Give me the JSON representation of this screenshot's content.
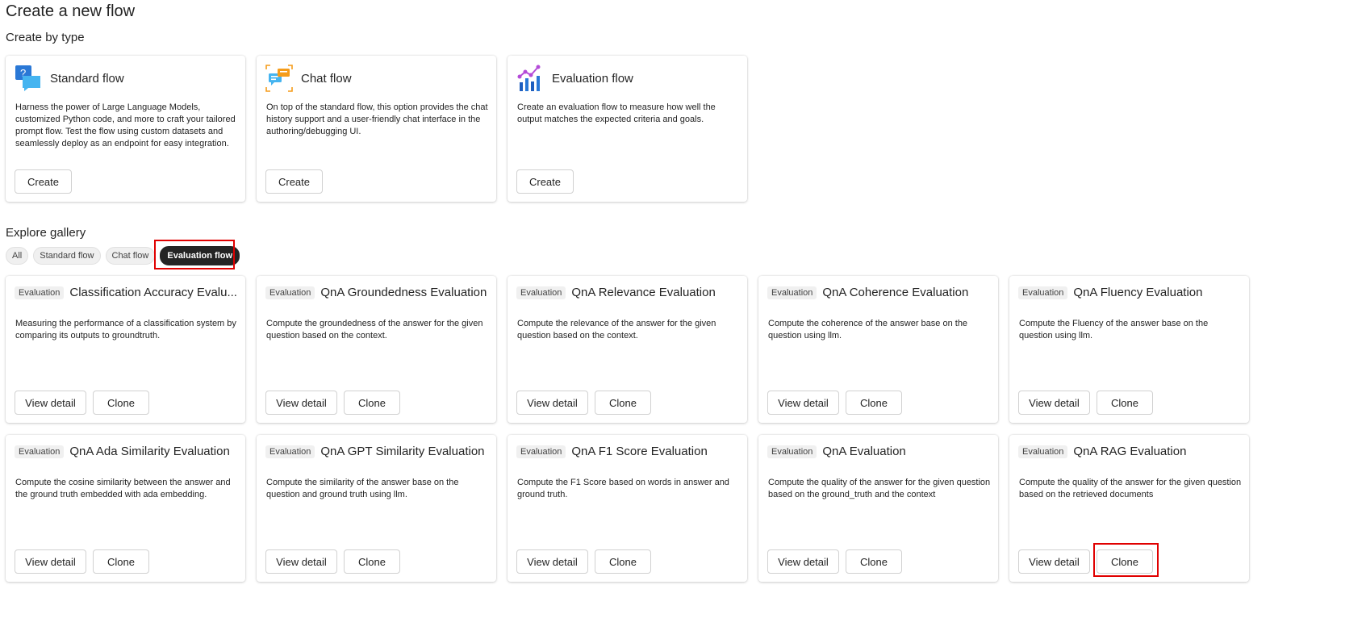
{
  "page": {
    "title": "Create a new flow"
  },
  "create_by_type": {
    "heading": "Create by type",
    "cards": [
      {
        "name": "Standard flow",
        "icon": "standard-flow-icon",
        "description": "Harness the power of Large Language Models, customized Python code, and more to craft your tailored prompt flow. Test the flow using custom datasets and seamlessly deploy as an endpoint for easy integration.",
        "button": "Create"
      },
      {
        "name": "Chat flow",
        "icon": "chat-flow-icon",
        "description": "On top of the standard flow, this option provides the chat history support and a user-friendly chat interface in the authoring/debugging UI.",
        "button": "Create"
      },
      {
        "name": "Evaluation flow",
        "icon": "evaluation-flow-icon",
        "description": "Create an evaluation flow to measure how well the output matches the expected criteria and goals.",
        "button": "Create"
      }
    ]
  },
  "gallery": {
    "heading": "Explore gallery",
    "filters": [
      "All",
      "Standard flow",
      "Chat flow",
      "Evaluation flow"
    ],
    "active_filter": "Evaluation flow",
    "badge": "Evaluation",
    "view_label": "View detail",
    "clone_label": "Clone",
    "items": [
      {
        "title": "Classification Accuracy Evalu...",
        "description": "Measuring the performance of a classification system by comparing its outputs to groundtruth."
      },
      {
        "title": "QnA Groundedness Evaluation",
        "description": "Compute the groundedness of the answer for the given question based on the context."
      },
      {
        "title": "QnA Relevance Evaluation",
        "description": "Compute the relevance of the answer for the given question based on the context."
      },
      {
        "title": "QnA Coherence Evaluation",
        "description": "Compute the coherence of the answer base on the question using llm."
      },
      {
        "title": "QnA Fluency Evaluation",
        "description": "Compute the Fluency of the answer base on the question using llm."
      },
      {
        "title": "QnA Ada Similarity Evaluation",
        "description": "Compute the cosine similarity between the answer and the ground truth embedded with ada embedding."
      },
      {
        "title": "QnA GPT Similarity Evaluation",
        "description": "Compute the similarity of the answer base on the question and ground truth using llm."
      },
      {
        "title": "QnA F1 Score Evaluation",
        "description": "Compute the F1 Score based on words in answer and ground truth."
      },
      {
        "title": "QnA Evaluation",
        "description": "Compute the quality of the answer for the given question based on the ground_truth and the context"
      },
      {
        "title": "QnA RAG Evaluation",
        "description": "Compute the quality of the answer for the given question based on the retrieved documents"
      }
    ]
  },
  "colors": {
    "highlight": "#e00000",
    "active_chip": "#242424"
  }
}
